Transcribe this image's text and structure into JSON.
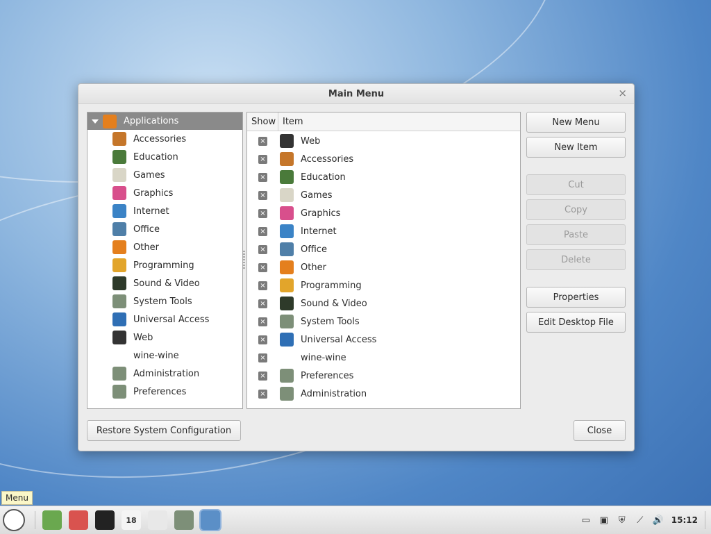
{
  "dialog": {
    "title": "Main Menu",
    "close_glyph": "×",
    "tree_root": "Applications",
    "tree_items": [
      {
        "label": "Accessories",
        "icon": "accessories-icon",
        "color": "#c5762a"
      },
      {
        "label": "Education",
        "icon": "education-icon",
        "color": "#4a7a3a"
      },
      {
        "label": "Games",
        "icon": "games-icon",
        "color": "#d9d6c7"
      },
      {
        "label": "Graphics",
        "icon": "graphics-icon",
        "color": "#d84f8c"
      },
      {
        "label": "Internet",
        "icon": "internet-icon",
        "color": "#3b83c6"
      },
      {
        "label": "Office",
        "icon": "office-icon",
        "color": "#4f7fa8"
      },
      {
        "label": "Other",
        "icon": "other-icon",
        "color": "#e47f1d"
      },
      {
        "label": "Programming",
        "icon": "programming-icon",
        "color": "#e2a52b"
      },
      {
        "label": "Sound & Video",
        "icon": "sound-video-icon",
        "color": "#2e3a2a"
      },
      {
        "label": "System Tools",
        "icon": "system-tools-icon",
        "color": "#7d8f78"
      },
      {
        "label": "Universal Access",
        "icon": "universal-access-icon",
        "color": "#2f6fb5"
      },
      {
        "label": "Web",
        "icon": "web-icon",
        "color": "#333333"
      },
      {
        "label": "wine-wine",
        "icon": "",
        "color": ""
      },
      {
        "label": "Administration",
        "icon": "administration-icon",
        "color": "#7d8f78"
      },
      {
        "label": "Preferences",
        "icon": "preferences-icon",
        "color": "#7d8f78"
      }
    ],
    "list_headers": {
      "show": "Show",
      "item": "Item"
    },
    "list_items": [
      {
        "label": "Web",
        "icon": "web-icon",
        "color": "#333333",
        "checked": "×"
      },
      {
        "label": "Accessories",
        "icon": "accessories-icon",
        "color": "#c5762a",
        "checked": "×"
      },
      {
        "label": "Education",
        "icon": "education-icon",
        "color": "#4a7a3a",
        "checked": "×"
      },
      {
        "label": "Games",
        "icon": "games-icon",
        "color": "#d9d6c7",
        "checked": "×"
      },
      {
        "label": "Graphics",
        "icon": "graphics-icon",
        "color": "#d84f8c",
        "checked": "×"
      },
      {
        "label": "Internet",
        "icon": "internet-icon",
        "color": "#3b83c6",
        "checked": "×"
      },
      {
        "label": "Office",
        "icon": "office-icon",
        "color": "#4f7fa8",
        "checked": "×"
      },
      {
        "label": "Other",
        "icon": "other-icon",
        "color": "#e47f1d",
        "checked": "×"
      },
      {
        "label": "Programming",
        "icon": "programming-icon",
        "color": "#e2a52b",
        "checked": "×"
      },
      {
        "label": "Sound & Video",
        "icon": "sound-video-icon",
        "color": "#2e3a2a",
        "checked": "×"
      },
      {
        "label": "System Tools",
        "icon": "system-tools-icon",
        "color": "#7d8f78",
        "checked": "×"
      },
      {
        "label": "Universal Access",
        "icon": "universal-access-icon",
        "color": "#2f6fb5",
        "checked": "×"
      },
      {
        "label": "wine-wine",
        "icon": "",
        "color": "",
        "checked": "×"
      },
      {
        "label": "Preferences",
        "icon": "preferences-icon",
        "color": "#7d8f78",
        "checked": "×"
      },
      {
        "label": "Administration",
        "icon": "administration-icon",
        "color": "#7d8f78",
        "checked": "×"
      }
    ],
    "buttons": {
      "new_menu": "New Menu",
      "new_item": "New Item",
      "cut": "Cut",
      "copy": "Copy",
      "paste": "Paste",
      "delete": "Delete",
      "properties": "Properties",
      "edit_desktop_file": "Edit Desktop File",
      "restore": "Restore System Configuration",
      "close": "Close"
    }
  },
  "taskbar": {
    "tooltip": "Menu",
    "launchers": [
      {
        "icon": "menu-icon",
        "color": "#3d3d3d"
      },
      {
        "icon": "file-manager-icon",
        "color": "#6aa84f"
      },
      {
        "icon": "browser-icon",
        "color": "#d9534f"
      },
      {
        "icon": "terminal-icon",
        "color": "#222222"
      },
      {
        "icon": "calendar-icon",
        "color": "#f4f4f4"
      },
      {
        "icon": "spreadsheet-icon",
        "color": "#e8e8e8"
      },
      {
        "icon": "system-tools-icon",
        "color": "#7d8f78"
      },
      {
        "icon": "text-editor-icon",
        "color": "#5b8fc7"
      }
    ],
    "calendar_day": "18",
    "clock": "15:12"
  }
}
